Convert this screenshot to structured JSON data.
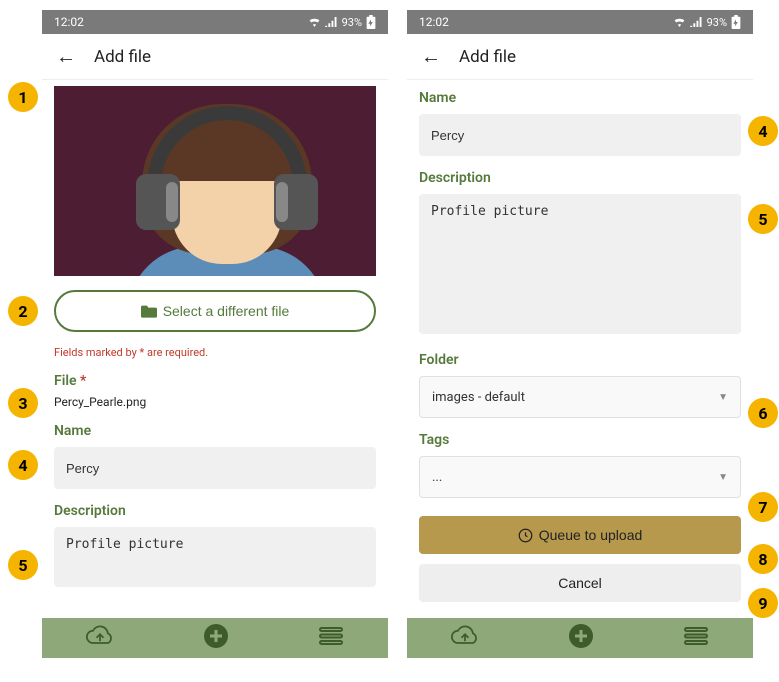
{
  "status": {
    "time": "12:02",
    "battery": "93%"
  },
  "appbar": {
    "title": "Add file"
  },
  "left": {
    "select_file_label": "Select a different file",
    "required_note": "Fields marked by * are required.",
    "file_label": "File",
    "file_value": "Percy_Pearle.png",
    "name_label": "Name",
    "name_value": "Percy",
    "description_label": "Description",
    "description_value": "Profile picture"
  },
  "right": {
    "name_label": "Name",
    "name_value": "Percy",
    "description_label": "Description",
    "description_value": "Profile picture",
    "folder_label": "Folder",
    "folder_value": "images - default",
    "tags_label": "Tags",
    "tags_value": "...",
    "queue_label": "Queue to upload",
    "cancel_label": "Cancel"
  },
  "badges": [
    "1",
    "2",
    "3",
    "4",
    "5",
    "4",
    "5",
    "6",
    "7",
    "8",
    "9"
  ]
}
